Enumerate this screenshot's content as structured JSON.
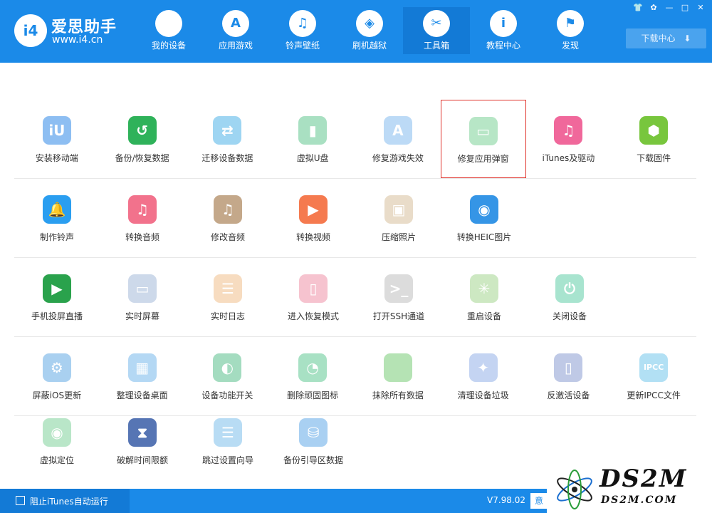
{
  "header": {
    "logo_mark": "i4",
    "logo_title": "爱思助手",
    "logo_url": "www.i4.cn",
    "nav": [
      {
        "label": "我的设备",
        "glyph": "",
        "icon": "apple-icon"
      },
      {
        "label": "应用游戏",
        "glyph": "A",
        "icon": "app-store-icon"
      },
      {
        "label": "铃声壁纸",
        "glyph": "♫",
        "icon": "music-icon"
      },
      {
        "label": "刷机越狱",
        "glyph": "◈",
        "icon": "dropbox-icon"
      },
      {
        "label": "工具箱",
        "glyph": "✂",
        "icon": "tools-icon"
      },
      {
        "label": "教程中心",
        "glyph": "i",
        "icon": "info-icon"
      },
      {
        "label": "发现",
        "glyph": "⚑",
        "icon": "flag-icon"
      }
    ],
    "active_nav": "工具箱",
    "window_controls": {
      "skin": "👕",
      "settings": "✿",
      "minimize": "—",
      "maximize": "□",
      "close": "✕"
    },
    "download_label": "下载中心",
    "download_glyph": "⬇"
  },
  "tools": {
    "rows": [
      [
        {
          "label": "安装移动端",
          "color": "#8dbef2",
          "glyph": "iU",
          "icon": "i4-app-icon"
        },
        {
          "label": "备份/恢复数据",
          "color": "#2fb25a",
          "glyph": "↺",
          "icon": "backup-clock-icon"
        },
        {
          "label": "迁移设备数据",
          "color": "#9ed5f2",
          "glyph": "⇄",
          "icon": "migrate-icon"
        },
        {
          "label": "虚拟U盘",
          "color": "#a9e0c2",
          "glyph": "▮",
          "icon": "usb-drive-icon"
        },
        {
          "label": "修复游戏失效",
          "color": "#bcdaf6",
          "glyph": "A",
          "icon": "app-store-icon"
        },
        {
          "label": "修复应用弹窗",
          "color": "#b7e6c6",
          "glyph": "▭",
          "icon": "apple-id-card-icon"
        },
        {
          "label": "iTunes及驱动",
          "color": "#f0689b",
          "glyph": "♫",
          "icon": "itunes-icon"
        },
        {
          "label": "下载固件",
          "color": "#78c63d",
          "glyph": "⬢",
          "icon": "firmware-cube-icon"
        }
      ],
      [
        {
          "label": "制作铃声",
          "color": "#2a9ef0",
          "glyph": "🔔",
          "icon": "bell-icon"
        },
        {
          "label": "转换音频",
          "color": "#f2728c",
          "glyph": "♫",
          "icon": "music-convert-icon"
        },
        {
          "label": "修改音频",
          "color": "#c4a88a",
          "glyph": "♫",
          "icon": "music-edit-icon"
        },
        {
          "label": "转换视频",
          "color": "#f57a4f",
          "glyph": "▶",
          "icon": "video-play-icon"
        },
        {
          "label": "压缩照片",
          "color": "#e9dcc9",
          "glyph": "▣",
          "icon": "photo-icon"
        },
        {
          "label": "转换HEIC图片",
          "color": "#3595e6",
          "glyph": "◉",
          "icon": "heic-image-icon"
        }
      ],
      [
        {
          "label": "手机投屏直播",
          "color": "#2aa24c",
          "glyph": "▶",
          "icon": "screen-cast-icon"
        },
        {
          "label": "实时屏幕",
          "color": "#cdd9ea",
          "glyph": "▭",
          "icon": "monitor-icon"
        },
        {
          "label": "实时日志",
          "color": "#f7dcc0",
          "glyph": "☰",
          "icon": "log-document-icon"
        },
        {
          "label": "进入恢复模式",
          "color": "#f6c3cf",
          "glyph": "▯",
          "icon": "recovery-phone-icon"
        },
        {
          "label": "打开SSH通道",
          "color": "#dcdcdc",
          "glyph": ">_",
          "icon": "terminal-icon"
        },
        {
          "label": "重启设备",
          "color": "#cde8c2",
          "glyph": "✳",
          "icon": "restart-icon"
        },
        {
          "label": "关闭设备",
          "color": "#a8e4cf",
          "glyph": "⏻",
          "icon": "power-icon"
        }
      ],
      [
        {
          "label": "屏蔽iOS更新",
          "color": "#a9d0f0",
          "glyph": "⚙",
          "icon": "block-update-gear-icon"
        },
        {
          "label": "整理设备桌面",
          "color": "#b4d8f4",
          "glyph": "▦",
          "icon": "desktop-grid-icon"
        },
        {
          "label": "设备功能开关",
          "color": "#a4dcc0",
          "glyph": "◐",
          "icon": "toggle-switch-icon"
        },
        {
          "label": "删除顽固图标",
          "color": "#a8e1c4",
          "glyph": "◔",
          "icon": "pie-delete-icon"
        },
        {
          "label": "抹除所有数据",
          "color": "#b5e3b4",
          "glyph": "",
          "icon": "apple-erase-icon"
        },
        {
          "label": "清理设备垃圾",
          "color": "#c4d4f2",
          "glyph": "✦",
          "icon": "broom-icon"
        },
        {
          "label": "反激活设备",
          "color": "#bfc9e6",
          "glyph": "▯",
          "icon": "deactivate-phone-icon"
        },
        {
          "label": "更新IPCC文件",
          "color": "#b2e0f4",
          "glyph": "IPCC",
          "icon": "ipcc-icon"
        }
      ],
      [
        {
          "label": "虚拟定位",
          "color": "#b9e6c8",
          "glyph": "◉",
          "icon": "location-pin-icon"
        },
        {
          "label": "破解时间限额",
          "color": "#5675b4",
          "glyph": "⧗",
          "icon": "hourglass-icon"
        },
        {
          "label": "跳过设置向导",
          "color": "#b8dcf4",
          "glyph": "☰",
          "icon": "skip-guide-icon"
        },
        {
          "label": "备份引导区数据",
          "color": "#a9d0f2",
          "glyph": "⛁",
          "icon": "boot-backup-icon"
        }
      ]
    ],
    "highlighted": "修复应用弹窗"
  },
  "statusbar": {
    "itunes_label": "阻止iTunes自动运行",
    "version": "V7.98.02",
    "feedback_label": "意"
  },
  "watermark": {
    "text": "DS2M",
    "sub": "DS2M.COM"
  }
}
